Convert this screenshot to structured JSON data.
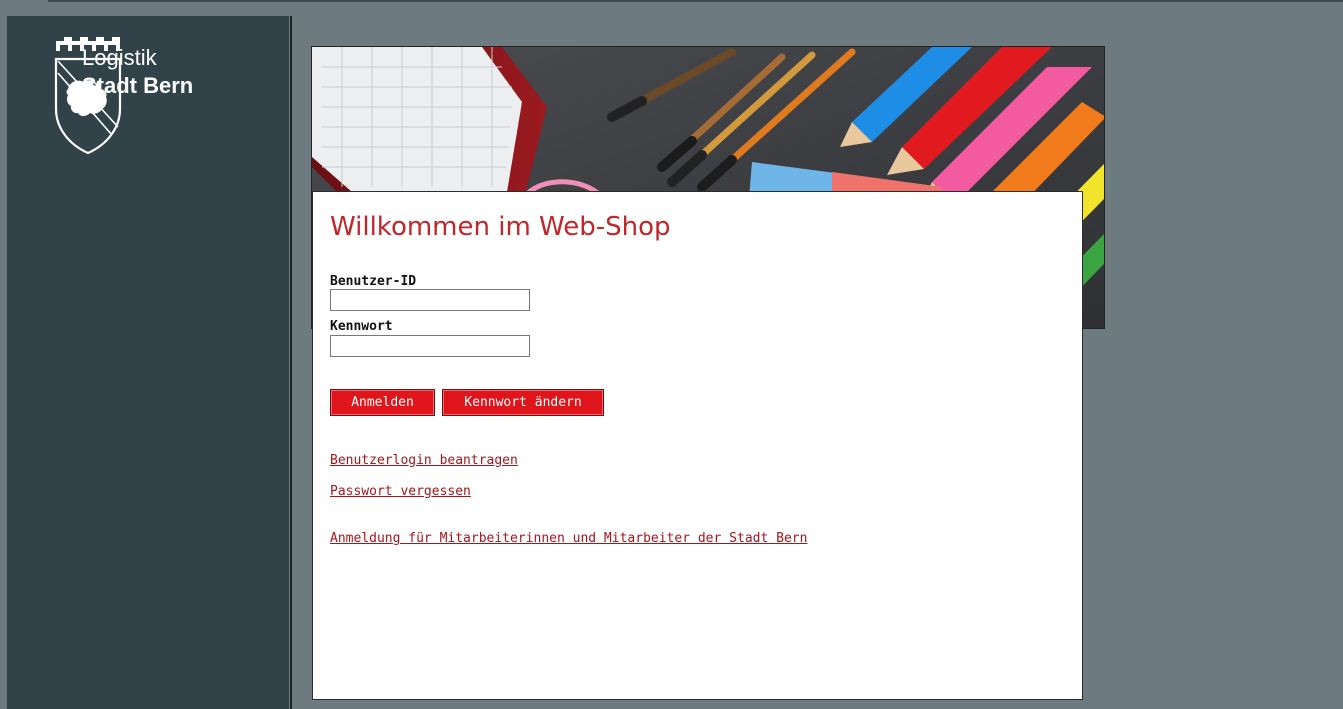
{
  "logo": {
    "line1": "Logistik",
    "line2": "Stadt Bern",
    "icon": "bern-coat-of-arms-icon"
  },
  "banner": {
    "image": "school-supplies-photo"
  },
  "login": {
    "title": "Willkommen im Web-Shop",
    "user_id_label": "Benutzer-ID",
    "user_id_value": "",
    "password_label": "Kennwort",
    "password_value": "",
    "login_button": "Anmelden",
    "change_password_button": "Kennwort ändern",
    "links": [
      "Benutzerlogin beantragen",
      "Passwort vergessen",
      "Anmeldung für Mitarbeiterinnen und Mitarbeiter der Stadt Bern"
    ]
  },
  "colors": {
    "accent_red": "#c1262b",
    "button_red": "#e0141b",
    "sidebar": "#314348",
    "background": "#6d7b81"
  }
}
